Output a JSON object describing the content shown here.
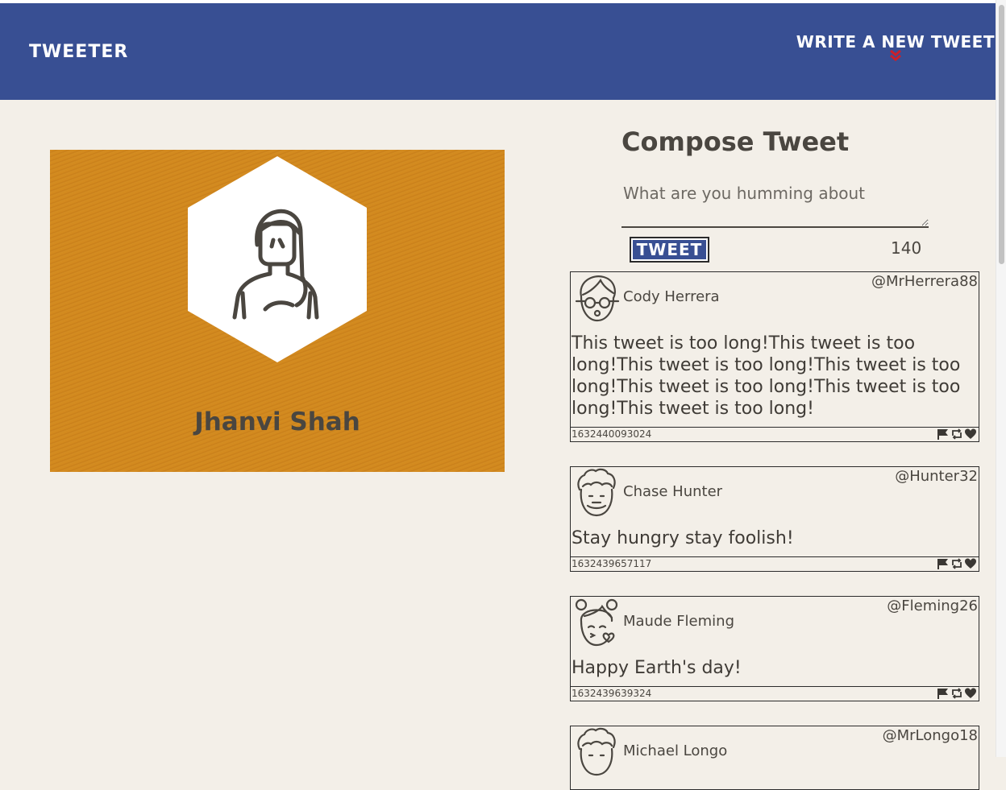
{
  "nav": {
    "brand": "TWEETER",
    "write_new": "WRITE A NEW TWEET",
    "accent": "#cc1f2a"
  },
  "profile": {
    "name": "Jhanvi Shah",
    "avatar_icon": "woman-avatar-icon",
    "background": "#d38a1f"
  },
  "compose": {
    "title": "Compose Tweet",
    "placeholder": "What are you humming about",
    "button_label": "TWEET",
    "counter": "140"
  },
  "tweets": [
    {
      "name": "Cody Herrera",
      "handle": "@MrHerrera88",
      "text": "This tweet is too long!This tweet is too long!This tweet is too long!This tweet is too long!This tweet is too long!This tweet is too long!This tweet is too long!",
      "time": "1632440093024",
      "avatar_icon": "man-glasses-avatar-icon"
    },
    {
      "name": "Chase Hunter",
      "handle": "@Hunter32",
      "text": "Stay hungry stay foolish!",
      "time": "1632439657117",
      "avatar_icon": "curly-hair-avatar-icon"
    },
    {
      "name": "Maude Fleming",
      "handle": "@Fleming26",
      "text": "Happy Earth's day!",
      "time": "1632439639324",
      "avatar_icon": "girl-kiss-avatar-icon"
    },
    {
      "name": "Michael Longo",
      "handle": "@MrLongo18",
      "avatar_icon": "curly-hair-avatar-icon"
    }
  ],
  "actions": [
    "flag-icon",
    "retweet-icon",
    "heart-icon"
  ]
}
